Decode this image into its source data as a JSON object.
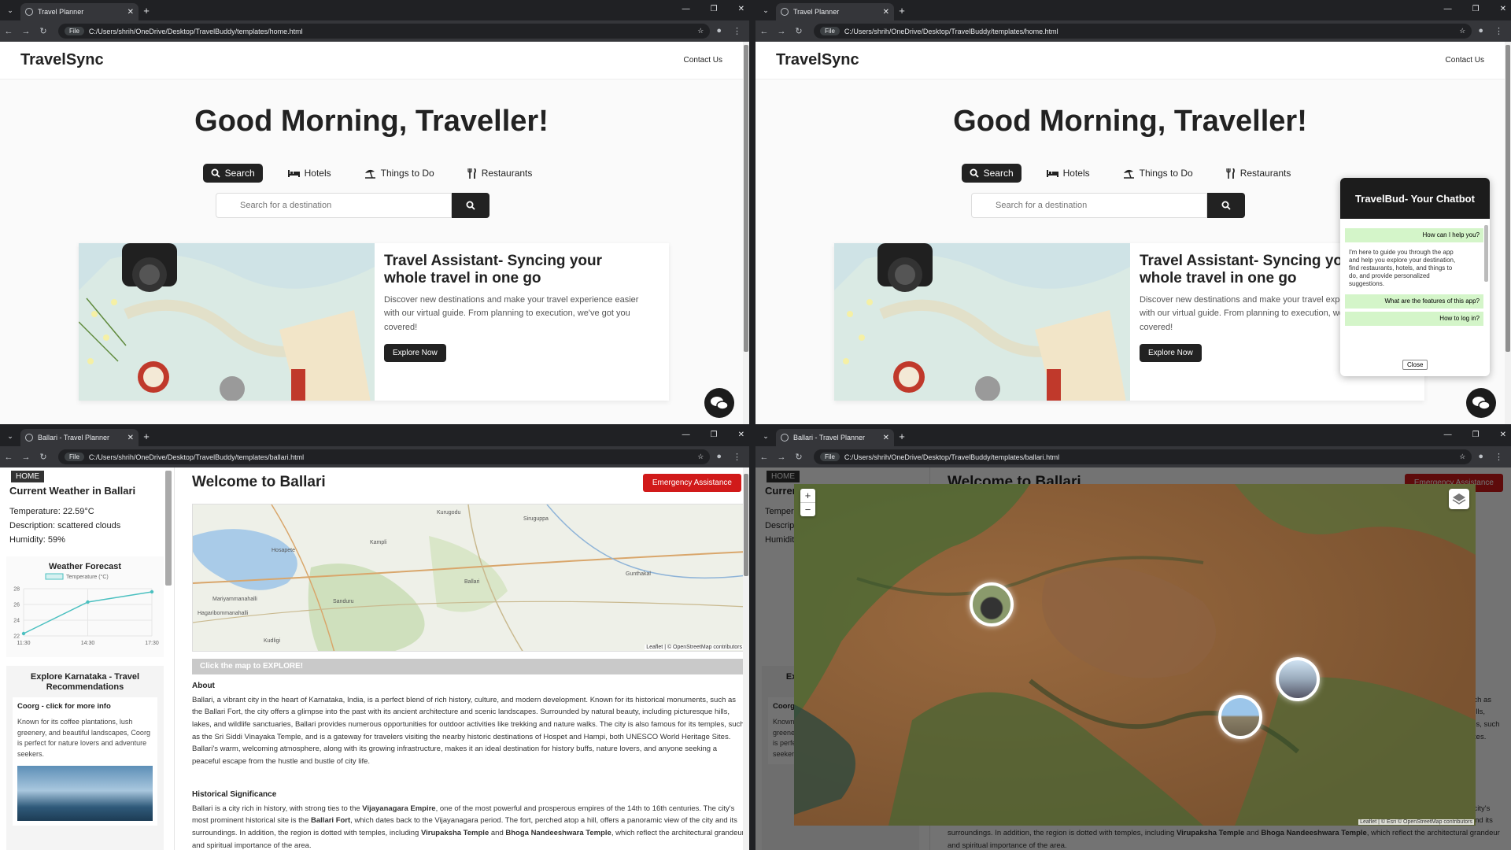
{
  "windows": {
    "home": {
      "tab_title": "Travel Planner",
      "url": "C:/Users/shrih/OneDrive/Desktop/TravelBuddy/templates/home.html",
      "file_badge": "File"
    },
    "ballari": {
      "tab_title": "Ballari - Travel Planner",
      "url": "C:/Users/shrih/OneDrive/Desktop/TravelBuddy/templates/ballari.html",
      "file_badge": "File"
    }
  },
  "home": {
    "brand": "TravelSync",
    "contact": "Contact Us",
    "greeting": "Good Morning, Traveller!",
    "tabs": [
      {
        "label": "Search",
        "icon": "search-icon"
      },
      {
        "label": "Hotels",
        "icon": "bed-icon"
      },
      {
        "label": "Things to Do",
        "icon": "umbrella-beach-icon"
      },
      {
        "label": "Restaurants",
        "icon": "utensils-icon"
      }
    ],
    "search_placeholder": "Search for a destination",
    "card": {
      "title": "Travel Assistant- Syncing your whole travel in one go",
      "desc": "Discover new destinations and make your travel experience easier with our virtual guide. From planning to execution, we've got you covered!",
      "button": "Explore Now"
    }
  },
  "chatbot": {
    "title": "TravelBud- Your Chatbot",
    "messages": [
      {
        "from": "user",
        "text": "How can I help you?"
      },
      {
        "from": "bot",
        "text": "I'm here to guide you through the app and help you explore your destination, find restaurants, hotels, and things to do, and provide personalized suggestions."
      },
      {
        "from": "user",
        "text": "What are the features of this app?"
      },
      {
        "from": "user",
        "text": "How to log in?"
      }
    ],
    "close": "Close"
  },
  "ballari": {
    "home_btn": "HOME",
    "weather_title": "Current Weather in Ballari",
    "temperature": "Temperature: 22.59°C",
    "description": "Description: scattered clouds",
    "humidity": "Humidity: 59%",
    "forecast_title": "Weather Forecast",
    "forecast_legend": "Temperature (°C)",
    "explore_title": "Explore Karnataka - Travel Recommendations",
    "coorg_title": "Coorg - click for more info",
    "coorg_desc": "Known for its coffee plantations, lush greenery, and beautiful landscapes, Coorg is perfect for nature lovers and adventure seekers.",
    "welcome": "Welcome to Ballari",
    "emergency": "Emergency Assistance",
    "map_explore": "Click the map to EXPLORE!",
    "map_places": [
      "Hosapete",
      "Ballari",
      "Kurugodu",
      "Sanduru",
      "Kampli",
      "Siruguppa",
      "Hagaribommanahalli",
      "Mariyammanahalli",
      "Gunthakal",
      "Kudligi"
    ],
    "map_attr": "Leaflet | © OpenStreetMap contributors",
    "about_h": "About",
    "about": "Ballari, a vibrant city in the heart of Karnataka, India, is a perfect blend of rich history, culture, and modern development. Known for its historical monuments, such as the Ballari Fort, the city offers a glimpse into the past with its ancient architecture and scenic landscapes. Surrounded by natural beauty, including picturesque hills, lakes, and wildlife sanctuaries, Ballari provides numerous opportunities for outdoor activities like trekking and nature walks. The city is also famous for its temples, such as the Sri Siddi Vinayaka Temple, and is a gateway for travelers visiting the nearby historic destinations of Hospet and Hampi, both UNESCO World Heritage Sites. Ballari's warm, welcoming atmosphere, along with its growing infrastructure, makes it an ideal destination for history buffs, nature lovers, and anyone seeking a peaceful escape from the hustle and bustle of city life.",
    "hist_h": "Historical Significance",
    "hist_1": "Ballari is a city rich in history, with strong ties to the ",
    "hist_b1": "Vijayanagara Empire",
    "hist_2": ", one of the most powerful and prosperous empires of the 14th to 16th centuries. The city's most prominent historical site is the ",
    "hist_b2": "Ballari Fort",
    "hist_3": ", which dates back to the Vijayanagara period. The fort, perched atop a hill, offers a panoramic view of the city and its surroundings. In addition, the region is dotted with temples, including ",
    "hist_b3": "Virupaksha Temple",
    "hist_4": " and ",
    "hist_b4": "Bhoga Nandeeshwara Temple",
    "hist_5": ", which reflect the architectural grandeur and spiritual importance of the area.",
    "sat_attr": "Leaflet | © Esri © OpenStreetMap contributors"
  },
  "chart_data": {
    "type": "line",
    "title": "Weather Forecast",
    "series": [
      {
        "name": "Temperature (°C)",
        "values": [
          22.3,
          26.3,
          27.6
        ]
      }
    ],
    "categories": [
      "11:30",
      "14:30",
      "17:30"
    ],
    "yticks": [
      22,
      24,
      26,
      28
    ],
    "ylim": [
      22,
      28
    ],
    "color": "#4bc0c0"
  },
  "colors": {
    "accent": "#222222",
    "emergency": "#d11a1a",
    "chat_user": "#d4f5c9"
  }
}
